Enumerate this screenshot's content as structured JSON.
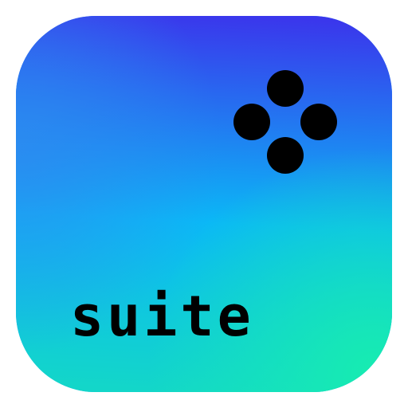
{
  "app_icon": {
    "wordmark": "suite",
    "logo_icon": "four-dot-diamond-icon",
    "colors": {
      "gradient_top": "#3a37ec",
      "gradient_middle": "#0bb8f6",
      "gradient_bottom_right": "#17ecb1",
      "gradient_left": "#2e8bf0",
      "foreground": "#000000",
      "background": "#ffffff"
    }
  }
}
